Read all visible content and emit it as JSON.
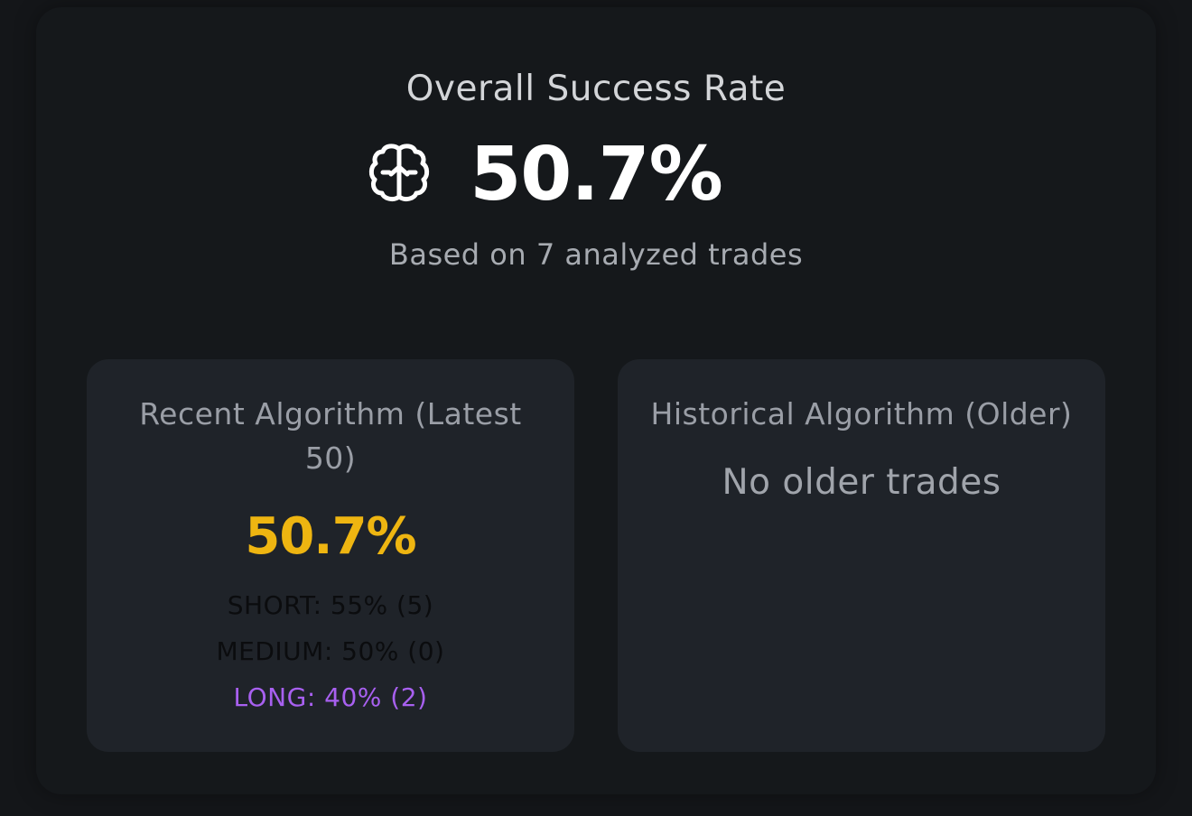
{
  "overall": {
    "title": "Overall Success Rate",
    "value": "50.7%",
    "subtitle": "Based on 7 analyzed trades",
    "icon": "brain-icon"
  },
  "recent": {
    "title": "Recent Algorithm (Latest 50)",
    "value": "50.7%",
    "breakdown": {
      "short": "SHORT: 55% (5)",
      "medium": "MEDIUM: 50% (0)",
      "long": "LONG: 40% (2)"
    }
  },
  "historical": {
    "title": "Historical Algorithm (Older)",
    "empty_message": "No older trades"
  },
  "colors": {
    "background": "#141619",
    "card": "#1f2329",
    "accent": "#eeb511",
    "long": "#a860f0"
  }
}
